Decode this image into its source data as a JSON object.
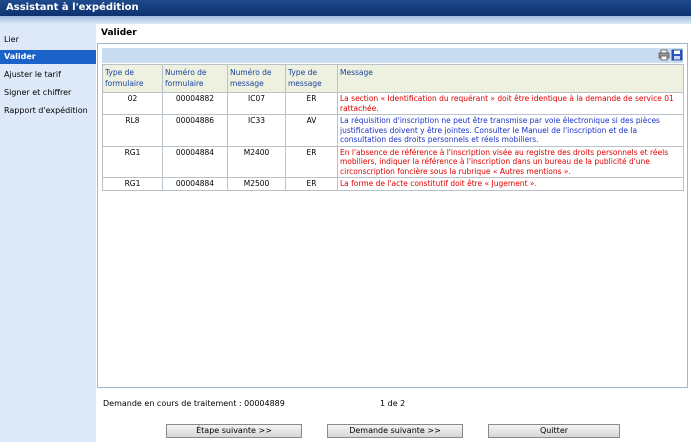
{
  "app": {
    "title": "Assistant à l'expédition"
  },
  "sidebar": {
    "items": [
      {
        "label": "Lier",
        "active": false
      },
      {
        "label": "Valider",
        "active": true
      },
      {
        "label": "Ajuster le tarif",
        "active": false
      },
      {
        "label": "Signer et chiffrer",
        "active": false
      },
      {
        "label": "Rapport d'expédition",
        "active": false
      }
    ]
  },
  "main": {
    "title": "Valider"
  },
  "toolbar": {
    "print_icon": "printer-icon",
    "save_icon": "floppy-disk-icon"
  },
  "table": {
    "headers": [
      "Type de formulaire",
      "Numéro de formulaire",
      "Numéro de message",
      "Type de message",
      "Message"
    ],
    "rows": [
      {
        "form_type": "02",
        "form_number": "00004882",
        "message_number": "IC07",
        "message_type": "ER",
        "message": "La section « Identification du requérant » doit être identique à la demande de service 01 rattachée.",
        "color": "#e00000"
      },
      {
        "form_type": "RL8",
        "form_number": "00004886",
        "message_number": "IC33",
        "message_type": "AV",
        "message": "La réquisition d'inscription ne peut être transmise par voie électronique si des pièces justificatives doivent y être jointes. Consulter le Manuel de l'inscription et de la consultation des droits personnels et réels mobiliers.",
        "color": "#1a33c8"
      },
      {
        "form_type": "RG1",
        "form_number": "00004884",
        "message_number": "M2400",
        "message_type": "ER",
        "message": "En l'absence de référence à l'inscription visée au registre des droits personnels et réels mobiliers, indiquer la référence à l'inscription dans un bureau de la publicité d'une circonscription foncière sous la rubrique « Autres mentions ».",
        "color": "#e00000"
      },
      {
        "form_type": "RG1",
        "form_number": "00004884",
        "message_number": "M2500",
        "message_type": "ER",
        "message": "La forme de l'acte constitutif doit être « Jugement ».",
        "color": "#e00000"
      }
    ]
  },
  "footer": {
    "request_label": "Demande en cours de traitement : 00004889",
    "pagination": "1 de 2"
  },
  "buttons": {
    "next_step": "Étape suivante >>",
    "next_request": "Demande suivante >>",
    "quit": "Quitter"
  }
}
